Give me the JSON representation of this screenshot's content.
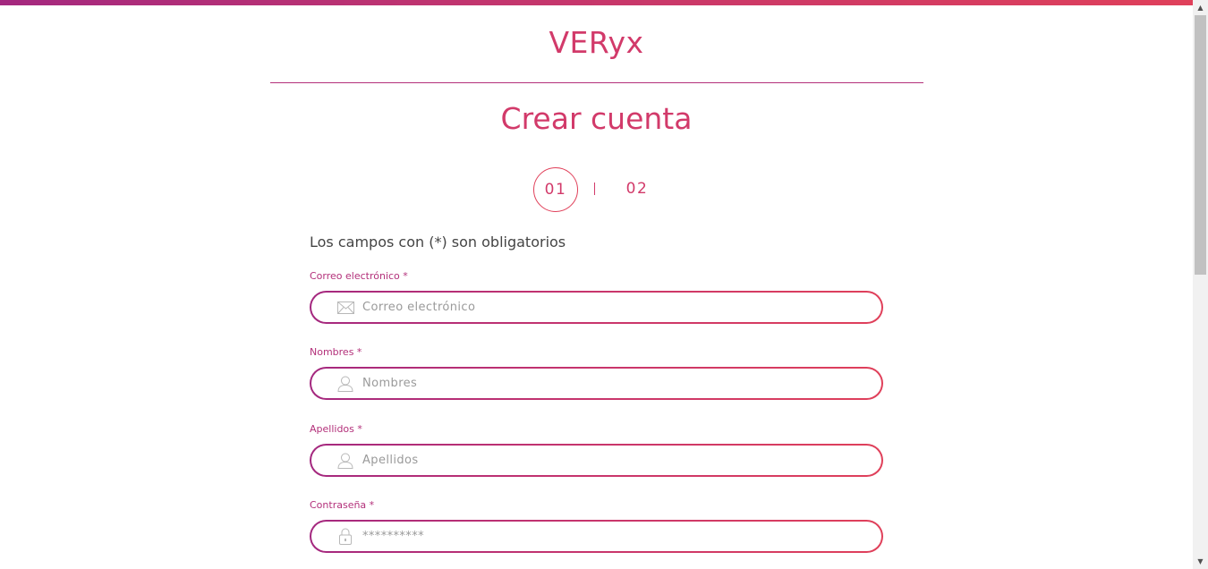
{
  "brand": {
    "name": "VERyx"
  },
  "header": {
    "title": "Crear cuenta"
  },
  "steps": {
    "current": "01",
    "separator": "|",
    "next": "02"
  },
  "form": {
    "required_note": "Los campos con (*) son obligatorios",
    "fields": [
      {
        "label": "Correo electrónico *",
        "placeholder": "Correo electrónico",
        "icon": "envelope-icon"
      },
      {
        "label": "Nombres *",
        "placeholder": "Nombres",
        "icon": "user-icon"
      },
      {
        "label": "Apellidos *",
        "placeholder": "Apellidos",
        "icon": "user-icon"
      },
      {
        "label": "Contraseña *",
        "placeholder": "**********",
        "icon": "lock-icon"
      }
    ]
  },
  "colors": {
    "accent": "#d23a6a",
    "gradient_start": "#a4287f",
    "gradient_end": "#e0405a",
    "label": "#b3307a"
  }
}
